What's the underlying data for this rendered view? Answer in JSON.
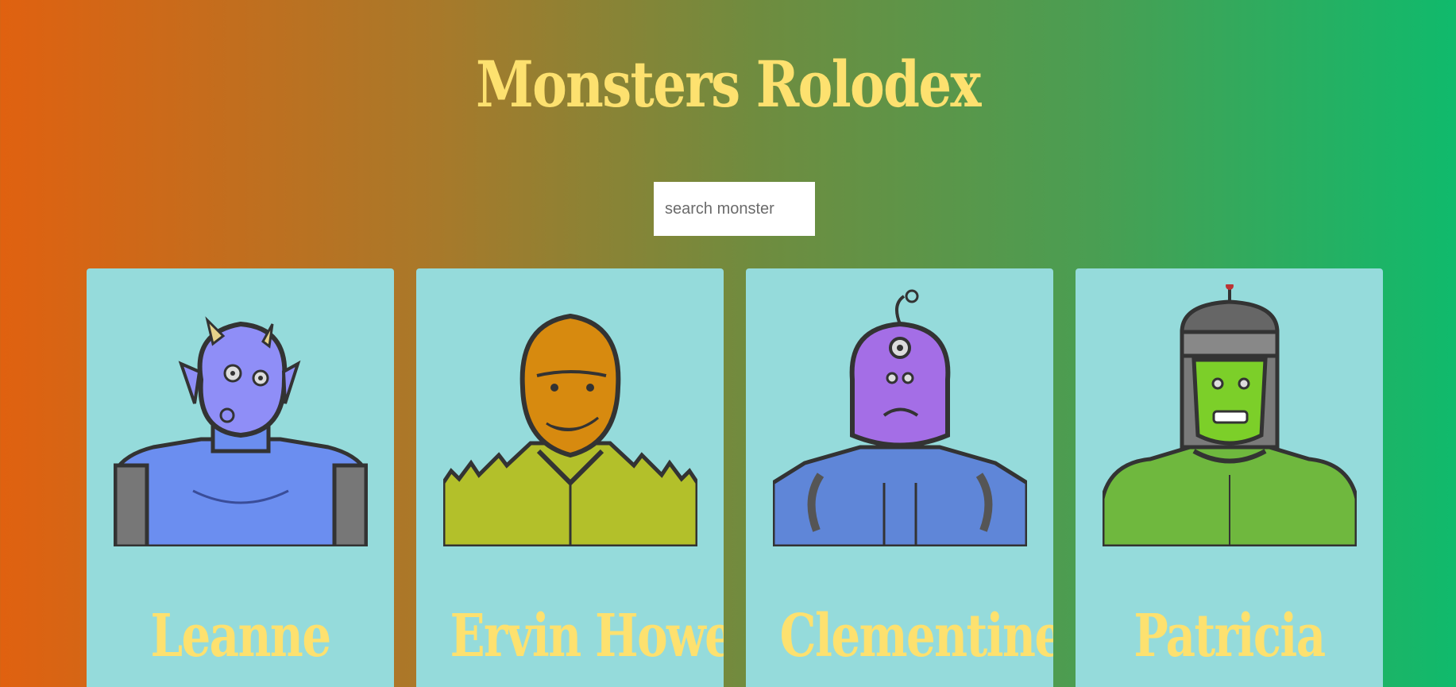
{
  "app": {
    "title": "Monsters Rolodex"
  },
  "search": {
    "placeholder": "search monster",
    "value": ""
  },
  "colors": {
    "title": "#fde16f",
    "card_bg": "#95dbdb",
    "gradient_start": "#e06110",
    "gradient_end": "#10ba6c"
  },
  "monsters": [
    {
      "name": "Leanne",
      "avatar_icon": "blue-horned-monster-icon"
    },
    {
      "name": "Ervin Howell",
      "avatar_icon": "orange-spiky-monster-icon"
    },
    {
      "name": "Clementine",
      "avatar_icon": "purple-cyclops-robot-monster-icon"
    },
    {
      "name": "Patricia",
      "avatar_icon": "green-frankenstein-monster-icon"
    }
  ]
}
